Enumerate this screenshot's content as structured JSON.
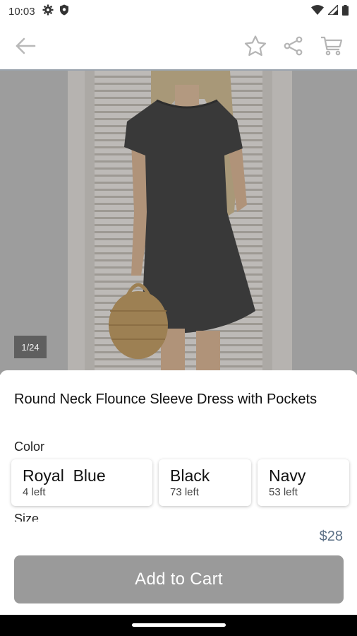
{
  "status_bar": {
    "time": "10:03",
    "icons": [
      "gear-icon",
      "shield-icon",
      "wifi-icon",
      "signal-icon",
      "battery-icon"
    ]
  },
  "app_bar": {
    "icons": [
      "back-arrow-icon",
      "star-icon",
      "share-icon",
      "cart-icon"
    ]
  },
  "gallery": {
    "counter": "1/24"
  },
  "product": {
    "title": "Round Neck Flounce Sleeve Dress with Pockets",
    "color_label": "Color",
    "size_label": "Size",
    "colors": [
      {
        "name": "Royal  Blue",
        "stock": "4 left"
      },
      {
        "name": "Black",
        "stock": "73 left"
      },
      {
        "name": "Navy",
        "stock": "53 left"
      }
    ]
  },
  "footer": {
    "price": "$28",
    "add_to_cart": "Add to Cart"
  },
  "colors": {
    "accent_price": "#5b7086",
    "button_bg": "#9a9a9a"
  }
}
